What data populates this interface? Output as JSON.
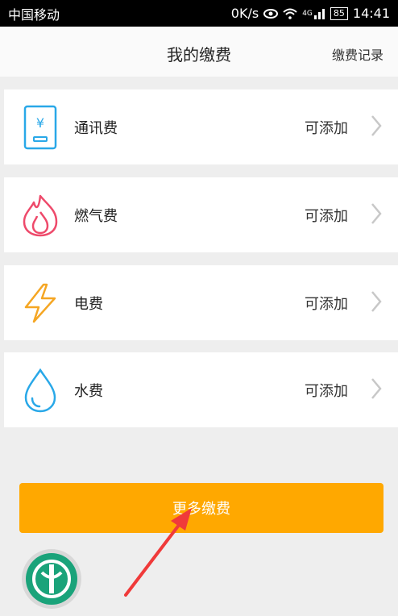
{
  "status_bar": {
    "carrier": "中国移动",
    "speed": "0K/s",
    "network": "4G",
    "battery": "85",
    "time": "14:41"
  },
  "header": {
    "title": "我的缴费",
    "record_link": "缴费记录"
  },
  "items": [
    {
      "label": "通讯费",
      "status": "可添加",
      "icon": "phone-bill-icon",
      "color": "#29a8e8"
    },
    {
      "label": "燃气费",
      "status": "可添加",
      "icon": "gas-flame-icon",
      "color": "#ee4a6b"
    },
    {
      "label": "电费",
      "status": "可添加",
      "icon": "lightning-icon",
      "color": "#f5a623"
    },
    {
      "label": "水费",
      "status": "可添加",
      "icon": "water-drop-icon",
      "color": "#29a8e8"
    }
  ],
  "more_button": {
    "label": "更多缴费"
  },
  "colors": {
    "accent": "#ffa800",
    "logo": "#1aa37a",
    "annotation_arrow": "#f03a3a"
  }
}
